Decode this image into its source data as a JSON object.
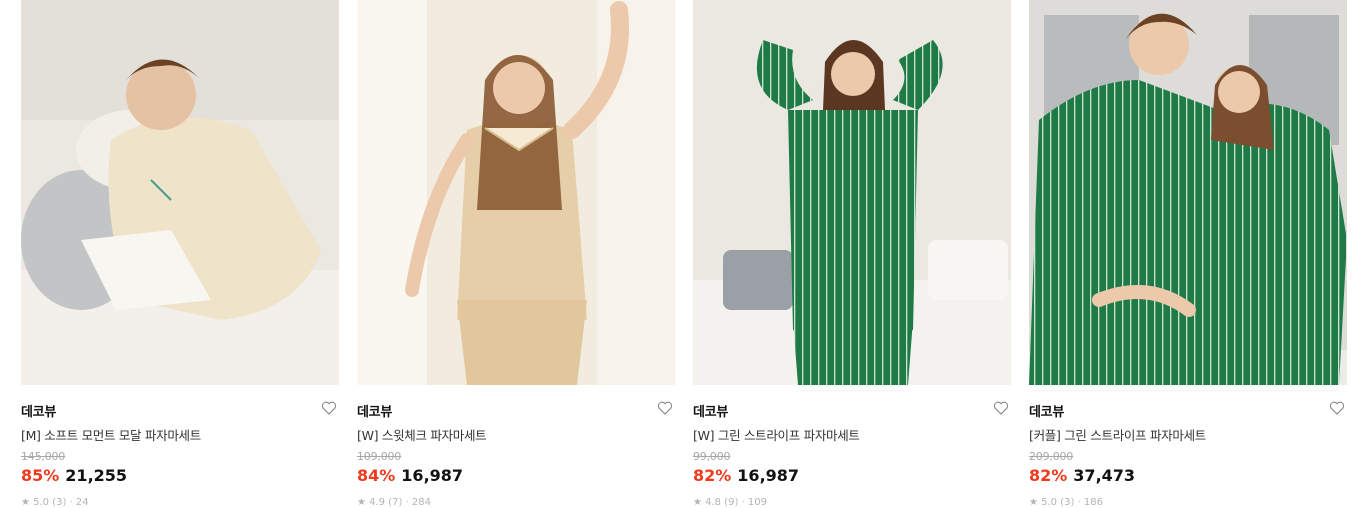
{
  "products": [
    {
      "brand": "데코뷰",
      "name": "[M] 소프트 모먼트 모달 파자마세트",
      "original_price": "145,000",
      "discount": "85%",
      "price": "21,255",
      "rating_partial": "★ 5.0 (3) · 24",
      "image_colors": {
        "background": "#e8e4dd",
        "garment": "#efe3c9",
        "bed": "#f4f1ec"
      }
    },
    {
      "brand": "데코뷰",
      "name": "[W] 스윗체크 파자마세트",
      "original_price": "109,000",
      "discount": "84%",
      "price": "16,987",
      "rating_partial": "★ 4.9 (7) · 284",
      "image_colors": {
        "background": "#f1e9dc",
        "garment": "#e6cfa8",
        "bed": "#f4eee4"
      }
    },
    {
      "brand": "데코뷰",
      "name": "[W] 그린 스트라이프 파자마세트",
      "original_price": "99,000",
      "discount": "82%",
      "price": "16,987",
      "rating_partial": "★ 4.8 (9) · 109",
      "image_colors": {
        "background": "#e9e6e0",
        "garment": "#1f7a46",
        "bed": "#f2f0ec"
      }
    },
    {
      "brand": "데코뷰",
      "name": "[커플] 그린 스트라이프 파자마세트",
      "original_price": "209,000",
      "discount": "82%",
      "price": "37,473",
      "rating_partial": "★ 5.0 (3) · 186",
      "image_colors": {
        "background": "#dcdcda",
        "garment": "#1f7a46",
        "bed": "#ecebe8"
      }
    }
  ],
  "icons": {
    "wishlist": "heart-outline-icon",
    "product_image": "product-photo"
  },
  "colors": {
    "discount": "#f2391d",
    "price": "#111111",
    "original_price": "#a8a8a8"
  }
}
